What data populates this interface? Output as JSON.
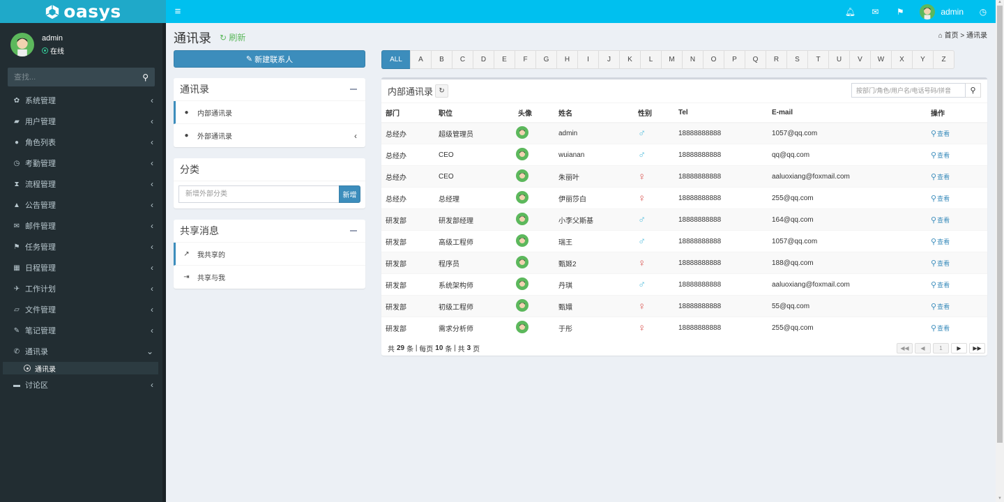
{
  "app": {
    "logo_text": "oasys"
  },
  "header": {
    "toggle_icon": "hamburger-icon",
    "icons": [
      "bell-icon",
      "envelope-icon",
      "flag-icon"
    ],
    "username": "admin",
    "clock_icon": "clock-icon"
  },
  "sidebar": {
    "user": {
      "name": "admin",
      "status": "在线"
    },
    "search_placeholder": "查找...",
    "items": [
      {
        "label": "系统管理",
        "icon": "gear-icon",
        "glyph": "✿",
        "expanded": false
      },
      {
        "label": "用户管理",
        "icon": "graduation-cap-icon",
        "glyph": "🎓",
        "expanded": false
      },
      {
        "label": "角色列表",
        "icon": "user-icon",
        "glyph": "👤",
        "expanded": false
      },
      {
        "label": "考勤管理",
        "icon": "clock-icon",
        "glyph": "◷",
        "expanded": false
      },
      {
        "label": "流程管理",
        "icon": "hourglass-icon",
        "glyph": "⌛",
        "expanded": false
      },
      {
        "label": "公告管理",
        "icon": "bell-icon",
        "glyph": "🔔",
        "expanded": false
      },
      {
        "label": "邮件管理",
        "icon": "envelope-icon",
        "glyph": "✉",
        "expanded": false
      },
      {
        "label": "任务管理",
        "icon": "flag-icon",
        "glyph": "⚑",
        "expanded": false
      },
      {
        "label": "日程管理",
        "icon": "calendar-icon",
        "glyph": "▦",
        "expanded": false
      },
      {
        "label": "工作计划",
        "icon": "plane-icon",
        "glyph": "✈",
        "expanded": false
      },
      {
        "label": "文件管理",
        "icon": "folder-open-icon",
        "glyph": "📂",
        "expanded": false
      },
      {
        "label": "笔记管理",
        "icon": "edit-icon",
        "glyph": "✎",
        "expanded": false
      },
      {
        "label": "通讯录",
        "icon": "phone-icon",
        "glyph": "✆",
        "expanded": true
      },
      {
        "label": "讨论区",
        "icon": "comment-icon",
        "glyph": "▰",
        "expanded": false
      }
    ],
    "subitem": {
      "label": "通讯录"
    }
  },
  "page": {
    "title": "通讯录",
    "refresh_label": "刷新",
    "breadcrumb": {
      "home": "首页",
      "sep": ">",
      "current": "通讯录"
    },
    "new_contact_label": "新建联系人"
  },
  "addressbook_box": {
    "title": "通讯录",
    "items": [
      {
        "label": "内部通讯录",
        "active": true
      },
      {
        "label": "外部通讯录",
        "active": false
      }
    ]
  },
  "category_box": {
    "title": "分类",
    "input_placeholder": "新增外部分类",
    "add_label": "新增"
  },
  "share_box": {
    "title": "共享消息",
    "items": [
      {
        "label": "我共享的",
        "active": true
      },
      {
        "label": "共享与我",
        "active": false
      }
    ]
  },
  "letters": [
    "ALL",
    "A",
    "B",
    "C",
    "D",
    "E",
    "F",
    "G",
    "H",
    "I",
    "J",
    "K",
    "L",
    "M",
    "N",
    "O",
    "P",
    "Q",
    "R",
    "S",
    "T",
    "U",
    "V",
    "W",
    "X",
    "Y",
    "Z"
  ],
  "active_letter": "ALL",
  "table_box": {
    "title": "内部通讯录",
    "search_placeholder": "按部门/角色/用户名/电话号码/拼音",
    "columns": [
      "部门",
      "职位",
      "头像",
      "姓名",
      "性别",
      "Tel",
      "E-mail",
      "操作"
    ],
    "action_label": "查看",
    "rows": [
      {
        "dept": "总经办",
        "position": "超级管理员",
        "name": "admin",
        "gender": "male",
        "tel": "18888888888",
        "email": "1057@qq.com"
      },
      {
        "dept": "总经办",
        "position": "CEO",
        "name": "wuianan",
        "gender": "male",
        "tel": "18888888888",
        "email": "qq@qq.com"
      },
      {
        "dept": "总经办",
        "position": "CEO",
        "name": "朱丽叶",
        "gender": "female",
        "tel": "18888888888",
        "email": "aaluoxiang@foxmail.com"
      },
      {
        "dept": "总经办",
        "position": "总经理",
        "name": "伊丽莎白",
        "gender": "female",
        "tel": "18888888888",
        "email": "255@qq.com"
      },
      {
        "dept": "研发部",
        "position": "研发部经理",
        "name": "小李父斯基",
        "gender": "male",
        "tel": "18888888888",
        "email": "164@qq.com"
      },
      {
        "dept": "研发部",
        "position": "高级工程师",
        "name": "瑞王",
        "gender": "male",
        "tel": "18888888888",
        "email": "1057@qq.com"
      },
      {
        "dept": "研发部",
        "position": "程序员",
        "name": "甄姬2",
        "gender": "female",
        "tel": "18888888888",
        "email": "188@qq.com"
      },
      {
        "dept": "研发部",
        "position": "系统架构师",
        "name": "丹琪",
        "gender": "male",
        "tel": "18888888888",
        "email": "aaluoxiang@foxmail.com"
      },
      {
        "dept": "研发部",
        "position": "初级工程师",
        "name": "甄嬛",
        "gender": "female",
        "tel": "18888888888",
        "email": "55@qq.com"
      },
      {
        "dept": "研发部",
        "position": "需求分析师",
        "name": "于彤",
        "gender": "female",
        "tel": "18888888888",
        "email": "255@qq.com"
      }
    ],
    "footer": {
      "total_prefix": "共",
      "total": "29",
      "total_unit": "条",
      "per_page_prefix": "每页",
      "per_page": "10",
      "per_page_unit": "条",
      "pages_prefix": "共",
      "pages": "3",
      "pages_unit": "页"
    },
    "pager": {
      "first": "⏮",
      "prev": "◀",
      "current": "1",
      "next": "▶",
      "last": "⏭"
    }
  },
  "colors": {
    "accent": "#3c8dbc",
    "topbar": "#00c0ef",
    "sidebar": "#222d32",
    "male": "#5bc0de",
    "female": "#d9534f",
    "online": "#33cc99"
  }
}
